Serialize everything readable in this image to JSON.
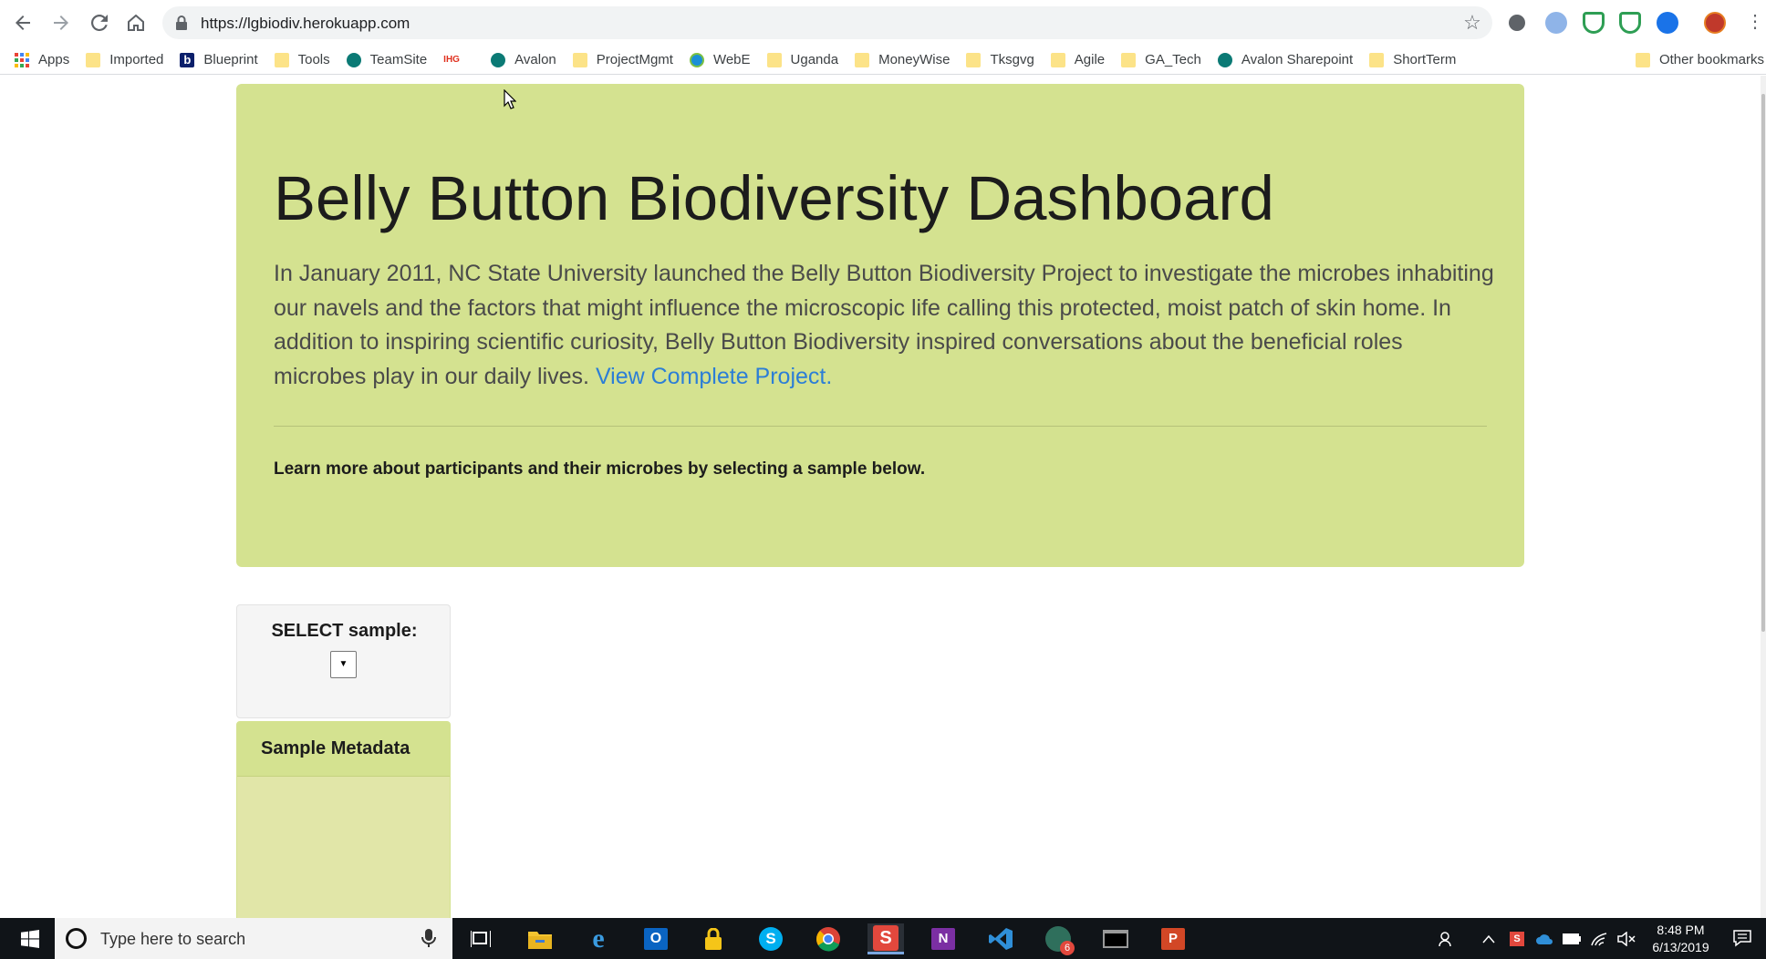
{
  "browser": {
    "url": "https://lgbiodiv.herokuapp.com",
    "bookmarks": [
      {
        "label": "Apps",
        "icon": "apps-grid-icon"
      },
      {
        "label": "Imported",
        "icon": "folder-icon"
      },
      {
        "label": "Blueprint",
        "icon": "blueprint-icon"
      },
      {
        "label": "Tools",
        "icon": "folder-icon"
      },
      {
        "label": "TeamSite",
        "icon": "sharepoint-icon"
      },
      {
        "label": "",
        "icon": "ihg-icon"
      },
      {
        "label": "Avalon",
        "icon": "sharepoint-icon"
      },
      {
        "label": "ProjectMgmt",
        "icon": "folder-icon"
      },
      {
        "label": "WebE",
        "icon": "webe-icon"
      },
      {
        "label": "Uganda",
        "icon": "folder-icon"
      },
      {
        "label": "MoneyWise",
        "icon": "folder-icon"
      },
      {
        "label": "Tksgvg",
        "icon": "folder-icon"
      },
      {
        "label": "Agile",
        "icon": "folder-icon"
      },
      {
        "label": "GA_Tech",
        "icon": "folder-icon"
      },
      {
        "label": "Avalon Sharepoint",
        "icon": "sharepoint-icon"
      },
      {
        "label": "ShortTerm",
        "icon": "folder-icon"
      }
    ],
    "other_bookmarks": "Other bookmarks"
  },
  "jumbotron": {
    "title": "Belly Button Biodiversity Dashboard",
    "lead": "In January 2011, NC State University launched the Belly Button Biodiversity Project to investigate the microbes inhabiting our navels and the factors that might influence the microscopic life calling this protected, moist patch of skin home. In addition to inspiring scientific curiosity, Belly Button Biodiversity inspired conversations about the beneficial roles microbes play in our daily lives.",
    "link": "View Complete Project.",
    "cta": "Learn more about participants and their microbes by selecting a sample below."
  },
  "selector": {
    "label": "SELECT sample:",
    "value": ""
  },
  "metadata": {
    "title": "Sample Metadata"
  },
  "taskbar": {
    "search_placeholder": "Type here to search",
    "time": "8:48 PM",
    "date": "6/13/2019",
    "badge": "6"
  },
  "colors": {
    "jumbotron_bg": "#d4e290",
    "panel_bg": "#e1e6a8",
    "link": "#2c7ed6",
    "taskbar": "#101418"
  }
}
